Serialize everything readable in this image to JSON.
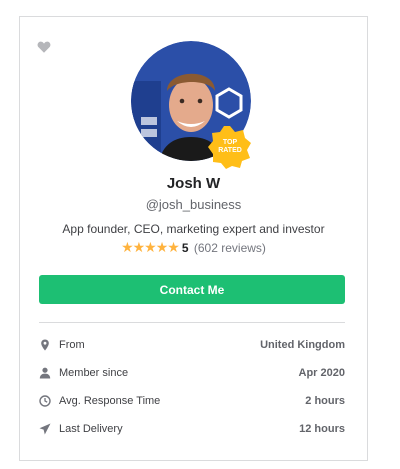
{
  "profile": {
    "name": "Josh W",
    "username": "@josh_business",
    "tagline": "App founder, CEO, marketing expert and investor",
    "badge": [
      "TOP",
      "RATED"
    ],
    "rating": {
      "stars_text": "★★★★★",
      "score": "5",
      "reviews": "(602 reviews)"
    }
  },
  "actions": {
    "contact_label": "Contact Me"
  },
  "stats": [
    {
      "icon": "location-pin-icon",
      "label": "From",
      "value": "United Kingdom"
    },
    {
      "icon": "user-icon",
      "label": "Member since",
      "value": "Apr 2020"
    },
    {
      "icon": "clock-icon",
      "label": "Avg. Response Time",
      "value": "2 hours"
    },
    {
      "icon": "paper-plane-icon",
      "label": "Last Delivery",
      "value": "12 hours"
    }
  ],
  "colors": {
    "accent_green": "#1dbf73",
    "star_gold": "#ffb33e",
    "badge_gold": "#ffbe18"
  }
}
